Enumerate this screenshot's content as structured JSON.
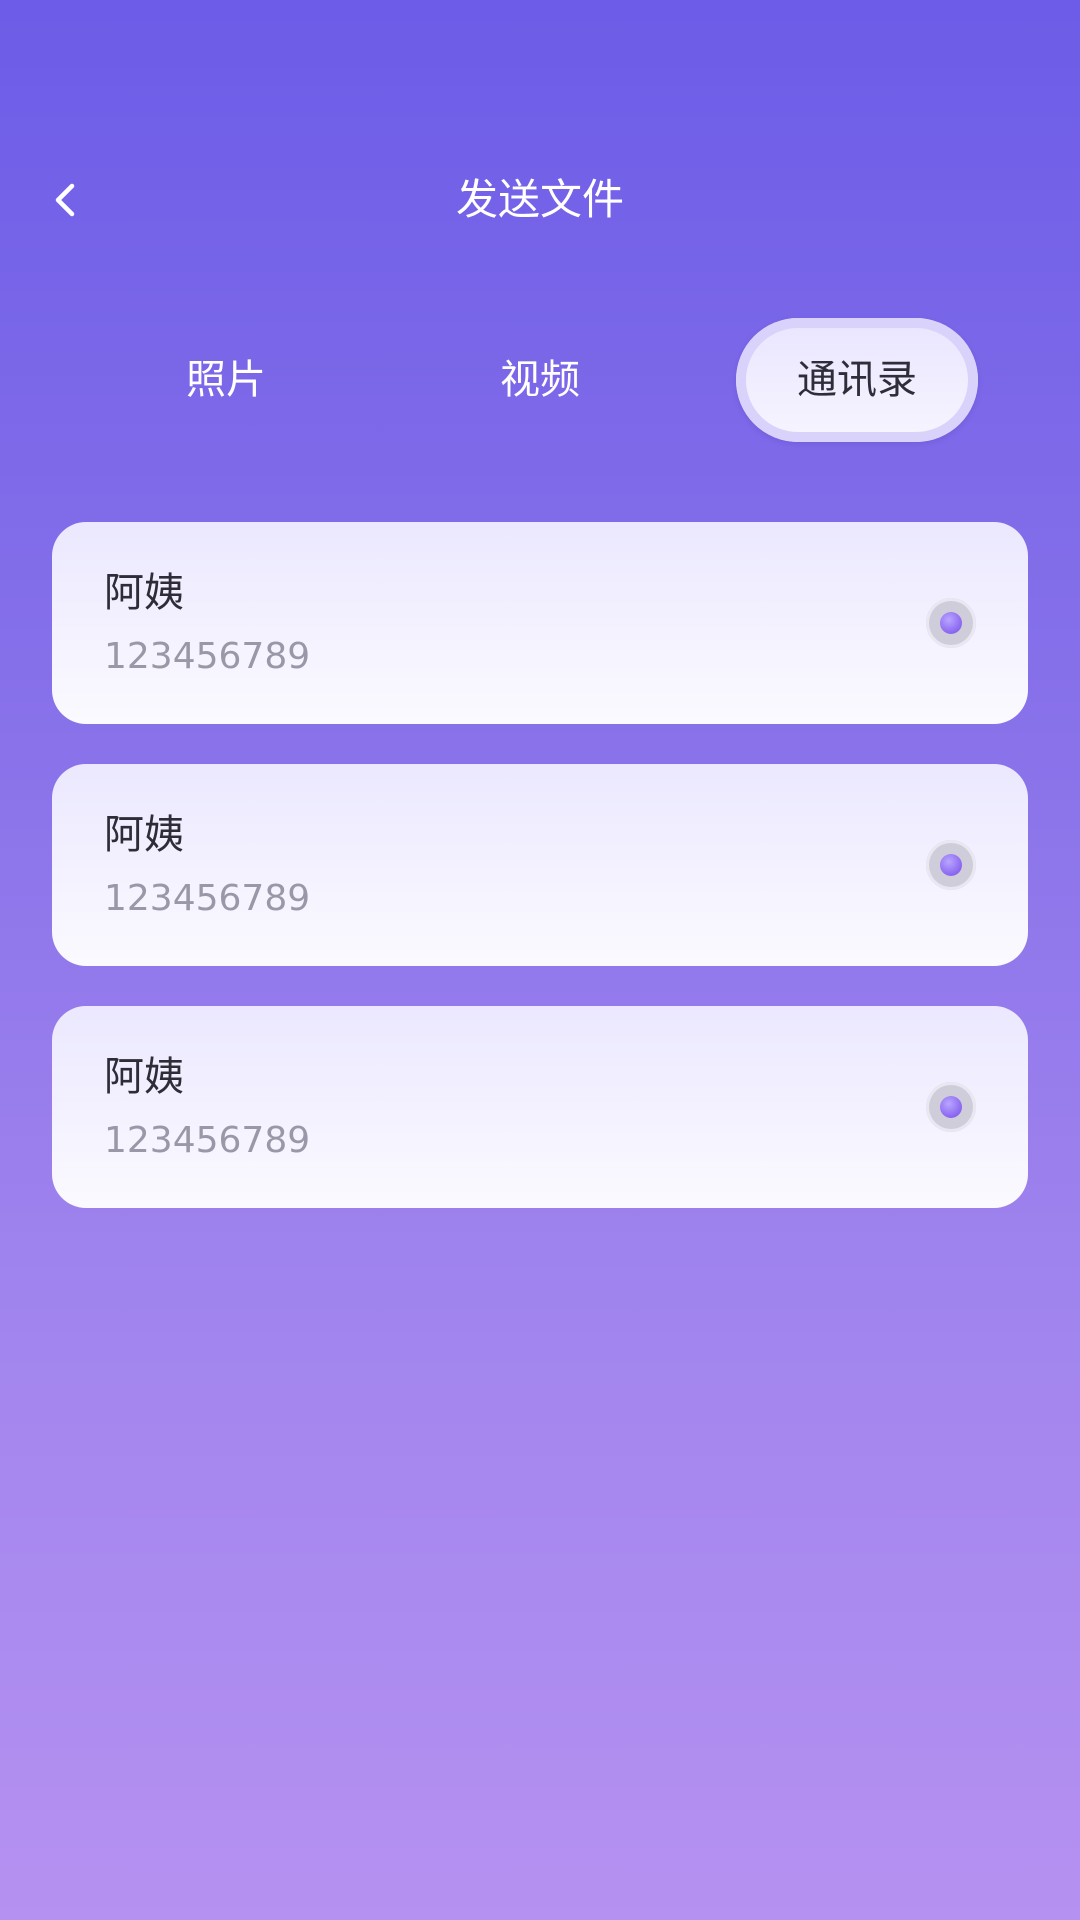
{
  "header": {
    "title": "发送文件",
    "back_icon": "chevron-left-icon"
  },
  "tabs": [
    {
      "label": "照片",
      "active": false
    },
    {
      "label": "视频",
      "active": false
    },
    {
      "label": "通讯录",
      "active": true
    }
  ],
  "contacts": [
    {
      "name": "阿姨",
      "phone": "123456789",
      "selected": false
    },
    {
      "name": "阿姨",
      "phone": "123456789",
      "selected": false
    },
    {
      "name": "阿姨",
      "phone": "123456789",
      "selected": false
    }
  ],
  "colors": {
    "background_top": "#6c5ce7",
    "background_bottom": "#b591f1",
    "card": "#f4f2ff",
    "accent": "#8a66f0"
  }
}
